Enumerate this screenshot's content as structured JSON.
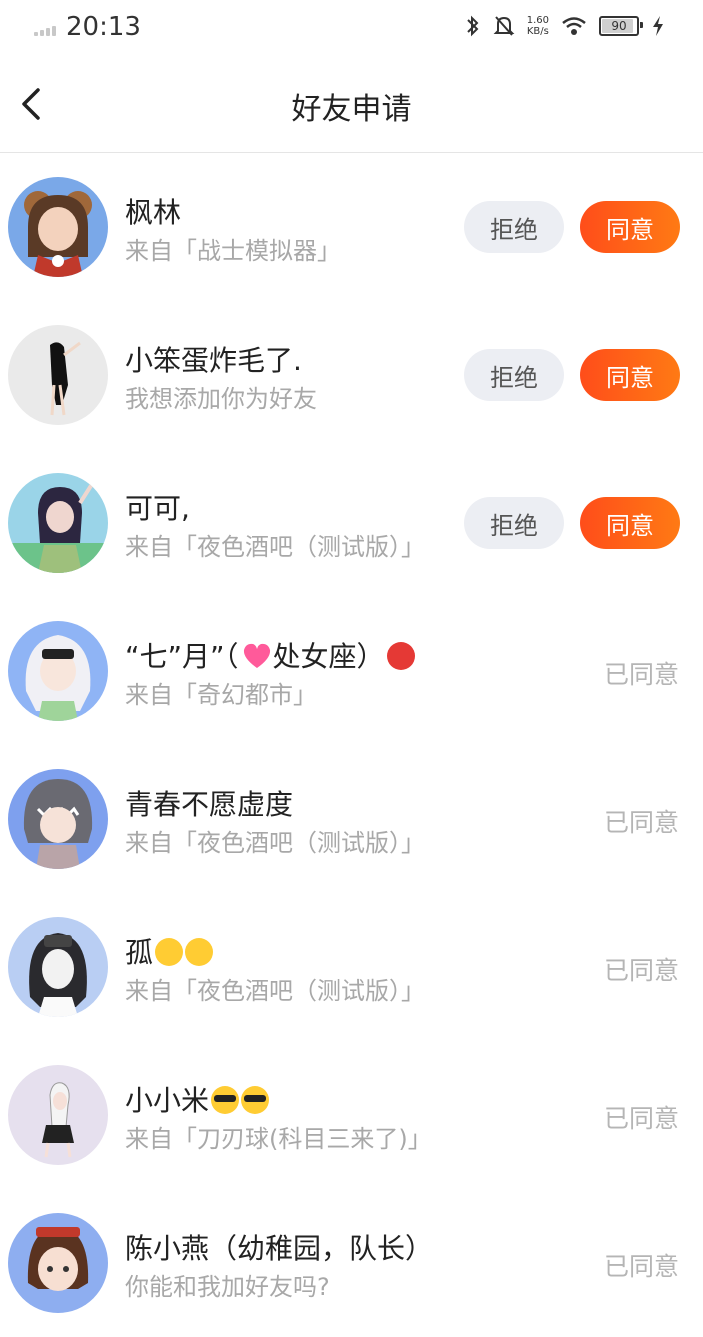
{
  "status_bar": {
    "time": "20:13",
    "net_speed_value": "1.60",
    "net_speed_unit": "KB/s",
    "battery": "90",
    "icons": [
      "signal-icon",
      "bluetooth-icon",
      "mute-icon",
      "wifi-icon",
      "battery-icon",
      "charging-icon"
    ]
  },
  "header": {
    "title": "好友申请"
  },
  "labels": {
    "reject": "拒绝",
    "accept": "同意",
    "agreed": "已同意"
  },
  "colors": {
    "accent": "#ff5a1a",
    "reject_bg": "#eceef3",
    "sub_text": "#a8a8a8"
  },
  "requests": [
    {
      "name": "枫林",
      "subtitle": "来自「战士模拟器」",
      "status": "pending"
    },
    {
      "name": "小笨蛋炸毛了.",
      "subtitle": "我想添加你为好友",
      "status": "pending"
    },
    {
      "name": "可可,",
      "subtitle": "来自「夜色酒吧（测试版）」",
      "status": "pending"
    },
    {
      "name": "“七”月”（",
      "name_emoji_mid": "heart",
      "name_after": "处女座）",
      "name_emoji_end": "angry",
      "subtitle": "来自「奇幻都市」",
      "status": "agreed"
    },
    {
      "name": "青春不愿虚度",
      "subtitle": "来自「夜色酒吧（测试版）」",
      "status": "agreed"
    },
    {
      "name": "孤",
      "name_emojis": [
        "sad",
        "sad"
      ],
      "subtitle": "来自「夜色酒吧（测试版）」",
      "status": "agreed"
    },
    {
      "name": "小小米",
      "name_emojis": [
        "cool",
        "cool"
      ],
      "subtitle": "来自「刀刃球(科目三来了)」",
      "status": "agreed"
    },
    {
      "name": "陈小燕（幼稚园，队长）",
      "subtitle": "你能和我加好友吗?",
      "status": "agreed"
    }
  ]
}
